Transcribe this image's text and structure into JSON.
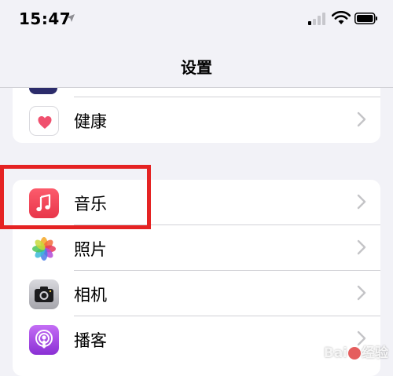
{
  "status_bar": {
    "time": "15:47",
    "icons": [
      "location-arrow-icon",
      "cellular-signal-icon",
      "wifi-icon",
      "battery-icon"
    ]
  },
  "nav": {
    "title": "设置"
  },
  "settings_groups": [
    {
      "items": [
        {
          "label": "健康",
          "icon": "heart-icon",
          "accent": "#f0506e"
        }
      ]
    },
    {
      "items": [
        {
          "label": "音乐",
          "icon": "music-note-icon",
          "accent": "#fa3c50",
          "highlighted": true
        },
        {
          "label": "照片",
          "icon": "photos-flower-icon",
          "accent": "#f5a623"
        },
        {
          "label": "相机",
          "icon": "camera-icon",
          "accent": "#8e8e93"
        },
        {
          "label": "播客",
          "icon": "podcasts-icon",
          "accent": "#a245e8"
        }
      ]
    }
  ],
  "colors": {
    "background": "#f2f2f7",
    "cell": "#ffffff",
    "highlight": "#e52323",
    "chevron": "#c4c4c7"
  },
  "watermark": {
    "text_left": "Bai",
    "text_right": "经验"
  }
}
